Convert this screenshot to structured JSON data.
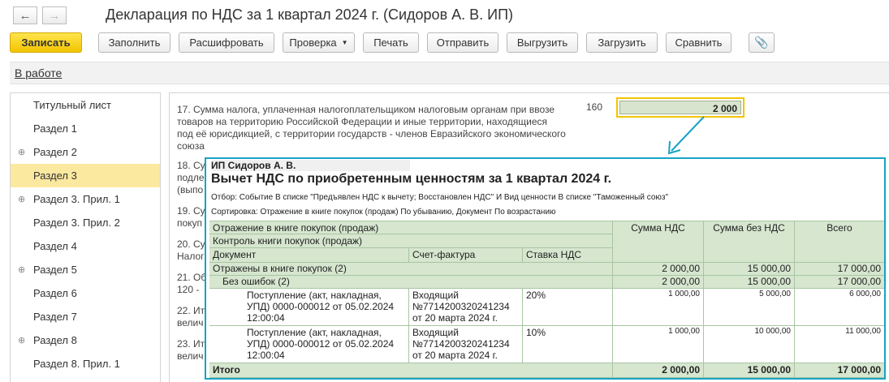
{
  "window": {
    "title": "Декларация по НДС за 1 квартал 2024 г. (Сидоров А. В. ИП)"
  },
  "toolbar": {
    "save_label": "Записать",
    "fill_label": "Заполнить",
    "decode_label": "Расшифровать",
    "check_label": "Проверка",
    "print_label": "Печать",
    "send_label": "Отправить",
    "export_label": "Выгрузить",
    "import_label": "Загрузить",
    "compare_label": "Сравнить"
  },
  "status_link": "В работе",
  "sidebar": {
    "items": [
      {
        "label": "Титульный лист"
      },
      {
        "label": "Раздел 1"
      },
      {
        "label": "Раздел 2"
      },
      {
        "label": "Раздел 3"
      },
      {
        "label": "Раздел 3. Прил. 1"
      },
      {
        "label": "Раздел 3. Прил. 2"
      },
      {
        "label": "Раздел 4"
      },
      {
        "label": "Раздел 5"
      },
      {
        "label": "Раздел 6"
      },
      {
        "label": "Раздел 7"
      },
      {
        "label": "Раздел 8"
      },
      {
        "label": "Раздел 8. Прил. 1"
      }
    ]
  },
  "content": {
    "line17": {
      "text1": "17. Сумма налога, уплаченная налогоплательщиком налоговым органам при ввозе",
      "text2": "товаров на территорию Российской Федерации и иные территории, находящиеся",
      "text3": "под её юрисдикцией, с территории государств - членов Евразийского экономического",
      "text4": "союза",
      "code": "160",
      "value": "2 000"
    },
    "partial": {
      "l18a": "18. Су",
      "l18b": "подле",
      "l18c": "(выпо",
      "l19a": "19. Су",
      "l19b": "покуп",
      "l20a": "20. Су",
      "l20b": "Налог",
      "l21a": "21. Об",
      "l21b": "120 -",
      "l22a": "22. Ит",
      "l22b": "велич",
      "l23a": "23. Ит",
      "l23b": "велич"
    }
  },
  "report": {
    "org": "ИП Сидоров А. В.",
    "title": "Вычет НДС по приобретенным ценностям за 1 квартал 2024 г.",
    "filter": "Отбор: Событие В списке \"Предъявлен НДС к вычету; Восстановлен НДС\" И Вид ценности В списке \"Таможенный союз\"",
    "sort": "Сортировка: Отражение в книге покупок (продаж) По убыванию, Документ По возрастанию",
    "headers": {
      "g1": "Отражение в книге покупок (продаж)",
      "g2": "Контроль книги покупок (продаж)",
      "doc": "Документ",
      "invoice": "Счет-фактура",
      "rate": "Ставка НДС",
      "vat": "Сумма НДС",
      "novat": "Сумма без НДС",
      "total": "Всего"
    },
    "group1": {
      "label": "Отражены в книге покупок (2)",
      "vat": "2 000,00",
      "novat": "15 000,00",
      "total": "17 000,00"
    },
    "group2": {
      "label": "Без ошибок (2)",
      "vat": "2 000,00",
      "novat": "15 000,00",
      "total": "17 000,00"
    },
    "rows": [
      {
        "doc1": "Поступление (акт, накладная,",
        "doc2": "УПД) 0000-000012 от 05.02.2024",
        "doc3": "12:00:04",
        "inv1": "Входящий",
        "inv2": "№7714200320241234",
        "inv3": "от 20 марта 2024 г.",
        "rate": "20%",
        "vat": "1 000,00",
        "novat": "5 000,00",
        "total": "6 000,00"
      },
      {
        "doc1": "Поступление (акт, накладная,",
        "doc2": "УПД) 0000-000012 от 05.02.2024",
        "doc3": "12:00:04",
        "inv1": "Входящий",
        "inv2": "№7714200320241234",
        "inv3": "от 20 марта 2024 г.",
        "rate": "10%",
        "vat": "1 000,00",
        "novat": "10 000,00",
        "total": "11 000,00"
      }
    ],
    "totals": {
      "label": "Итого",
      "vat": "2 000,00",
      "novat": "15 000,00",
      "total": "17 000,00"
    }
  }
}
